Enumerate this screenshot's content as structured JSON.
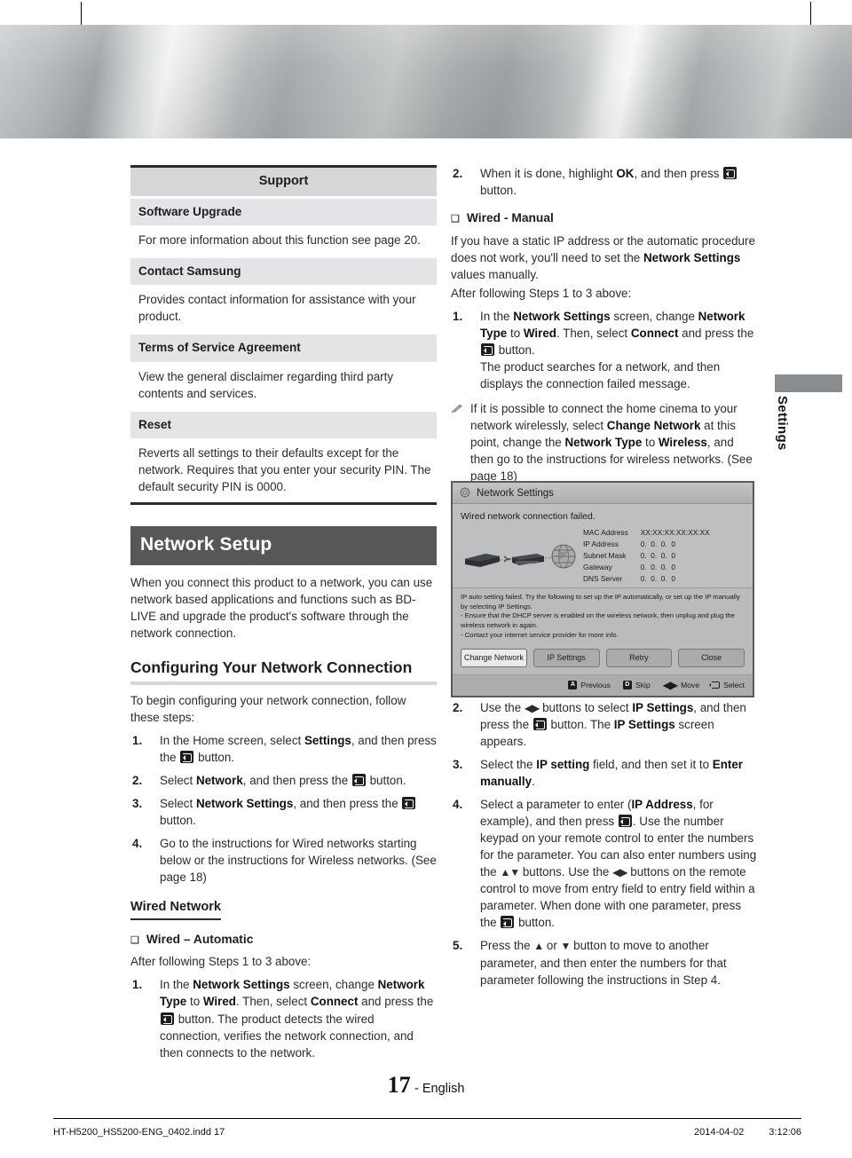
{
  "page": {
    "number": "17",
    "language": "- English"
  },
  "side_tab": {
    "label": "Settings"
  },
  "footer": {
    "file": "HT-H5200_HS5200-ENG_0402.indd   17",
    "date": "2014-04-02",
    "time": "3:12:06"
  },
  "support_table": {
    "title": "Support",
    "rows": [
      {
        "heading": "Software Upgrade",
        "body": "For more information about this function see page 20."
      },
      {
        "heading": "Contact Samsung",
        "body": "Provides contact information for assistance with your product."
      },
      {
        "heading": "Terms of Service Agreement",
        "body": "View the general disclaimer regarding third party contents and services."
      },
      {
        "heading": "Reset",
        "body": "Reverts all settings to their defaults except for the network. Requires that you enter your security PIN. The default security PIN is 0000."
      }
    ]
  },
  "network_setup": {
    "bar_title": "Network Setup",
    "intro": "When you connect this product to a network, you can use network based applications and functions such as BD-LIVE and upgrade the product's software through the network connection.",
    "sub_heading": "Configuring Your Network Connection",
    "sub_intro": "To begin configuring your network connection, follow these steps:",
    "steps": [
      {
        "num": "1.",
        "text_html": "In the Home screen, select <b>Settings</b>, and then press the <span class=\"ebtn\" data-name=\"enter-button-icon\" data-interactable=\"false\"></span> button."
      },
      {
        "num": "2.",
        "text_html": "Select <b>Network</b>, and then press the <span class=\"ebtn\" data-name=\"enter-button-icon\" data-interactable=\"false\"></span> button."
      },
      {
        "num": "3.",
        "text_html": "Select <b>Network Settings</b>, and then press the <span class=\"ebtn\" data-name=\"enter-button-icon\" data-interactable=\"false\"></span> button."
      },
      {
        "num": "4.",
        "text_html": "Go to the instructions for Wired networks starting below or the instructions for Wireless networks. (See page 18)"
      }
    ]
  },
  "wired_network": {
    "heading": "Wired Network",
    "automatic": {
      "bullet": "Wired – Automatic",
      "intro": "After following Steps 1 to 3 above:",
      "steps": [
        {
          "num": "1.",
          "text_html": "In the <b>Network Settings</b> screen, change <b>Network Type</b> to <b>Wired</b>. Then, select <b>Connect</b> and press the <span class=\"ebtn\" data-name=\"enter-button-icon\" data-interactable=\"false\"></span> button. The product detects the wired connection, verifies the network connection, and then connects to the network."
        },
        {
          "num": "2.",
          "text_html": "When it is done, highlight <b>OK</b>, and then press <span class=\"ebtn\" data-name=\"enter-button-icon\" data-interactable=\"false\"></span> button."
        }
      ]
    },
    "manual": {
      "bullet": "Wired - Manual",
      "intro_html": "If you have a static IP address or the automatic procedure does not work, you'll need to set the <b>Network Settings</b> values manually.",
      "intro2": "After following Steps 1 to 3 above:",
      "steps": [
        {
          "num": "1.",
          "text_html": "In the <b>Network Settings</b> screen, change <b>Network Type</b> to <b>Wired</b>. Then, select <b>Connect</b> and press the <span class=\"ebtn\" data-name=\"enter-button-icon\" data-interactable=\"false\"></span> button.<br>The product searches for a network, and then displays the connection failed message."
        }
      ],
      "note_html": "If it is possible to connect the home cinema to your network wirelessly, select <b>Change Network</b> at this point, change the <b>Network Type</b> to <b>Wireless</b>, and then go to the instructions for wireless networks. (See page 18)",
      "steps_after": [
        {
          "num": "2.",
          "text_html": "Use the <span class=\"arrows\">◀▶</span> buttons to select <b>IP Settings</b>, and then press the <span class=\"ebtn\" data-name=\"enter-button-icon\" data-interactable=\"false\"></span> button. The <b>IP Settings</b> screen appears."
        },
        {
          "num": "3.",
          "text_html": "Select the <b>IP setting</b> field, and then set it to <b>Enter manually</b>."
        },
        {
          "num": "4.",
          "text_html": "Select a parameter to enter (<b>IP Address</b>, for example), and then press <span class=\"ebtn\" data-name=\"enter-button-icon\" data-interactable=\"false\"></span>. Use the number keypad on your remote control to enter the numbers for the parameter. You can also enter numbers using the <span class=\"arrows\">▲▼</span> buttons. Use the <span class=\"arrows\">◀▶</span> buttons on the remote control to move from entry field to entry field within a parameter. When done with one parameter, press the <span class=\"ebtn\" data-name=\"enter-button-icon\" data-interactable=\"false\"></span> button."
        },
        {
          "num": "5.",
          "text_html": "Press the <span class=\"arrows\">▲</span> or <span class=\"arrows\">▼</span> button to move to another parameter, and then enter the numbers for that parameter following the instructions in Step 4."
        }
      ]
    }
  },
  "dialog": {
    "title": "Network Settings",
    "message": "Wired network connection failed.",
    "info_rows": [
      {
        "key": "MAC Address",
        "value": "XX:XX:XX:XX:XX:XX"
      },
      {
        "key": "IP Address",
        "value": "0.  0.  0.  0"
      },
      {
        "key": "Subnet Mask",
        "value": "0.  0.  0.  0"
      },
      {
        "key": "Gateway",
        "value": "0.  0.  0.  0"
      },
      {
        "key": "DNS Server",
        "value": "0.  0.  0.  0"
      }
    ],
    "help_lines": [
      "IP auto setting failed. Try the following to set up the IP automatically, or set up the IP manually by selecting IP Settings.",
      "- Ensure that the DHCP server is enabled on the wireless network, then unplug and plug the wireless network in again.",
      "- Contact your internet service provider for more info."
    ],
    "buttons": [
      {
        "label": "Change Network",
        "selected": true
      },
      {
        "label": "IP Settings",
        "selected": false
      },
      {
        "label": "Retry",
        "selected": false
      },
      {
        "label": "Close",
        "selected": false
      }
    ],
    "nav": [
      {
        "key": "A",
        "label": "Previous"
      },
      {
        "key": "D",
        "label": "Skip"
      },
      {
        "key": "arrows",
        "label": "Move"
      },
      {
        "key": "enter",
        "label": "Select"
      }
    ]
  },
  "colors": {
    "section_bar": "#575757",
    "table_title_bg": "#d5d7d9",
    "table_head_bg": "#e3e4e6",
    "side_tab_bar": "#8a8d90"
  }
}
